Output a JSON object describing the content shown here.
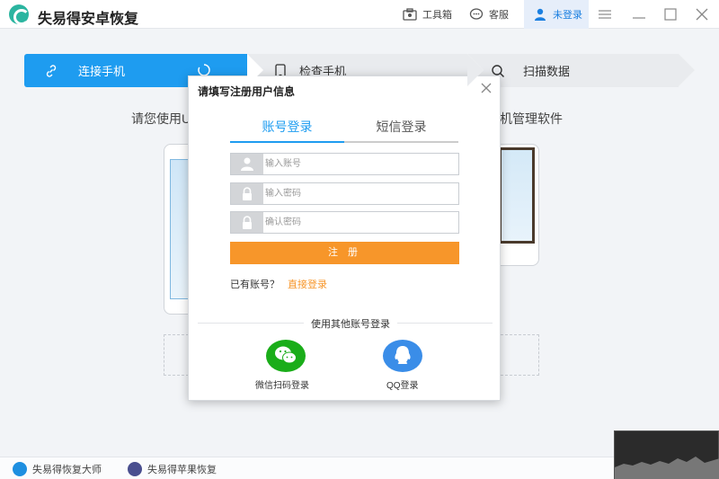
{
  "titlebar": {
    "app_title": "失易得安卓恢复",
    "toolbox_label": "工具箱",
    "service_label": "客服",
    "login_label": "未登录"
  },
  "steps": [
    {
      "label": "连接手机",
      "active": true
    },
    {
      "label": "检查手机",
      "active": false
    },
    {
      "label": "扫描数据",
      "active": false
    }
  ],
  "main": {
    "hint_left": "请您使用U",
    "hint_right": "机管理软件"
  },
  "modal": {
    "title": "请填写注册用户信息",
    "tabs": [
      {
        "label": "账号登录",
        "active": true
      },
      {
        "label": "短信登录",
        "active": false
      }
    ],
    "account_placeholder": "输入账号",
    "password_placeholder": "输入密码",
    "confirm_placeholder": "确认密码",
    "register_label": "注 册",
    "have_account": "已有账号？",
    "direct_login": "直接登录",
    "other_login": "使用其他账号登录",
    "wechat_label": "微信扫码登录",
    "qq_label": "QQ登录"
  },
  "bottom": {
    "item1": "失易得恢复大师",
    "item2": "失易得苹果恢复"
  },
  "colors": {
    "accent": "#1e9cf0",
    "register": "#f7962a",
    "wechat": "#1aad19",
    "qq": "#3a8de8"
  }
}
